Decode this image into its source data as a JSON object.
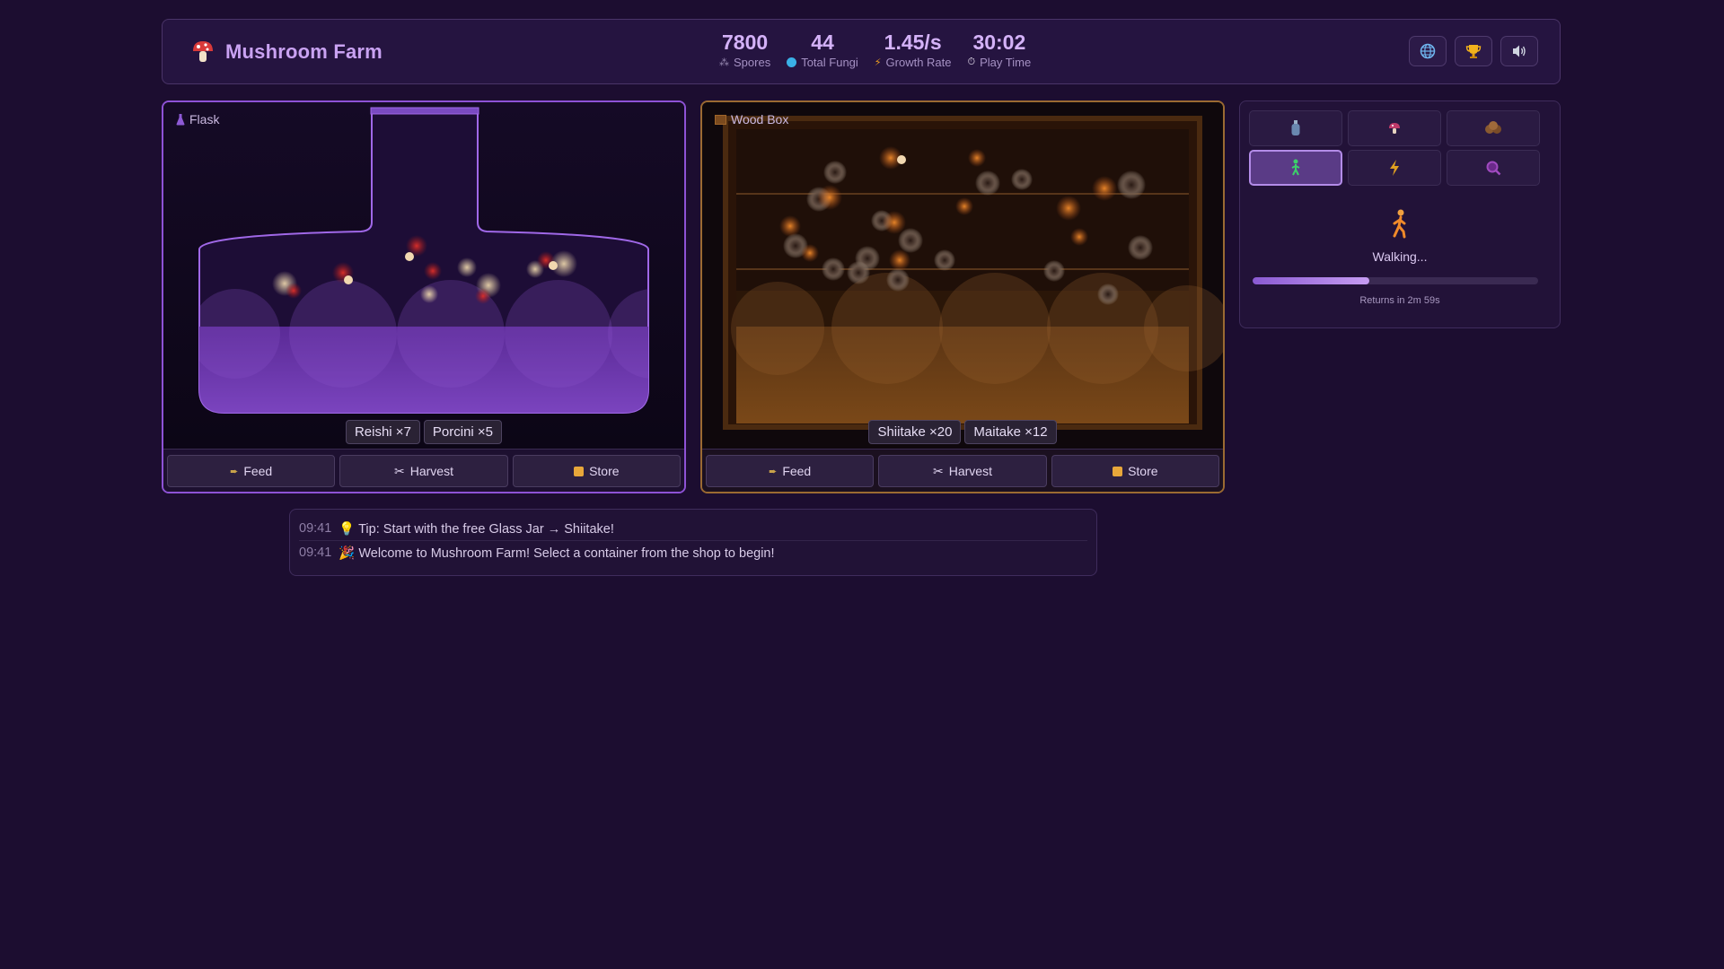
{
  "header": {
    "title": "Mushroom Farm",
    "logo_icon": "mushroom-icon",
    "stats": [
      {
        "value": "7800",
        "label": "Spores",
        "icon": "spores-icon"
      },
      {
        "value": "44",
        "label": "Total Fungi",
        "icon": "fungi-icon"
      },
      {
        "value": "1.45/s",
        "label": "Growth Rate",
        "icon": "lightning-icon"
      },
      {
        "value": "30:02",
        "label": "Play Time",
        "icon": "stopwatch-icon"
      }
    ],
    "buttons": [
      "globe-icon",
      "trophy-icon",
      "speaker-icon"
    ]
  },
  "containers": [
    {
      "name": "Flask",
      "icon": "flask-icon",
      "border_color": "#8e52d6",
      "counts": [
        "Reishi ×7",
        "Porcini ×5"
      ],
      "actions": {
        "feed": "Feed",
        "harvest": "Harvest",
        "store": "Store"
      }
    },
    {
      "name": "Wood Box",
      "icon": "wood-box-icon",
      "border_color": "#9b6a32",
      "counts": [
        "Shiitake ×20",
        "Maitake ×12"
      ],
      "actions": {
        "feed": "Feed",
        "harvest": "Harvest",
        "store": "Store"
      }
    }
  ],
  "side": {
    "tools": [
      "bottle-icon",
      "mushroom-icon",
      "spore-cluster-icon",
      "walker-icon",
      "lightning-icon",
      "magnifier-icon"
    ],
    "active_tool": "walker-icon",
    "status": "Walking...",
    "progress": 0.41,
    "returns": "Returns in 2m 59s"
  },
  "log": [
    {
      "time": "09:41",
      "text": "💡 Tip: Start with the free Glass Jar → Shiitake!"
    },
    {
      "time": "09:41",
      "text": "🎉 Welcome to Mushroom Farm! Select a container from the shop to begin!"
    }
  ]
}
